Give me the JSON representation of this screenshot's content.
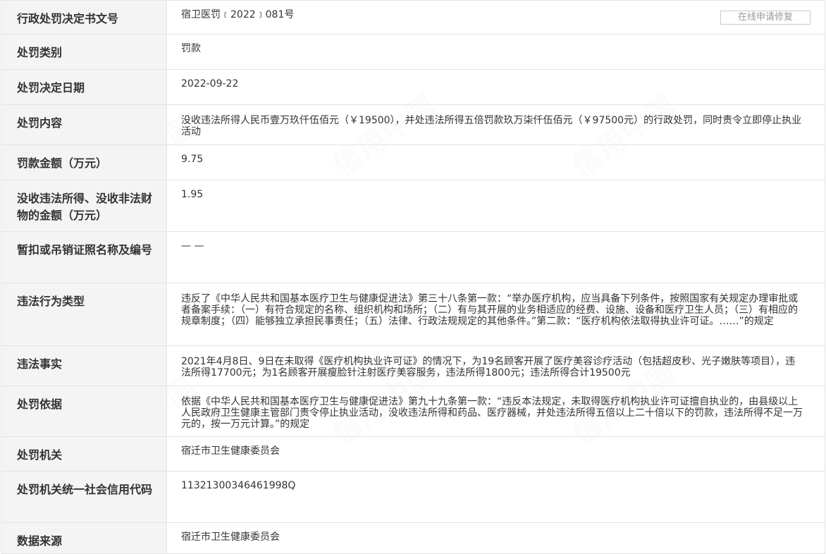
{
  "repair_button_label": "在线申请修复",
  "watermark_text": "信用中国",
  "rows": [
    {
      "label": "行政处罚决定书文号",
      "value": "宿卫医罚﹝2022﹞081号"
    },
    {
      "label": "处罚类别",
      "value": "罚款"
    },
    {
      "label": "处罚决定日期",
      "value": "2022-09-22"
    },
    {
      "label": "处罚内容",
      "value": "没收违法所得人民币壹万玖仟伍佰元（￥19500），并处违法所得五倍罚款玖万柒仟伍佰元（￥97500元）的行政处罚，同时责令立即停止执业活动"
    },
    {
      "label": "罚款金额（万元）",
      "value": "9.75"
    },
    {
      "label": "没收违法所得、没收非法财物的金额（万元）",
      "value": "1.95"
    },
    {
      "label": "暂扣或吊销证照名称及编号",
      "value": "— —"
    },
    {
      "label": "违法行为类型",
      "value": "违反了《中华人民共和国基本医疗卫生与健康促进法》第三十八条第一款：“举办医疗机构，应当具备下列条件，按照国家有关规定办理审批或者备案手续：（一）有符合规定的名称、组织机构和场所；（二）有与其开展的业务相适应的经费、设施、设备和医疗卫生人员；（三）有相应的规章制度；（四）能够独立承担民事责任；（五）法律、行政法规规定的其他条件。”第二款：“医疗机构依法取得执业许可证。……”的规定"
    },
    {
      "label": "违法事实",
      "value": "2021年4月8日、9日在未取得《医疗机构执业许可证》的情况下，为19名顾客开展了医疗美容诊疗活动（包括超皮秒、光子嫩肤等项目），违法所得17700元；为1名顾客开展瘦脸针注射医疗美容服务，违法所得1800元；违法所得合计19500元"
    },
    {
      "label": "处罚依据",
      "value": "依据《中华人民共和国基本医疗卫生与健康促进法》第九十九条第一款：“违反本法规定，未取得医疗机构执业许可证擅自执业的，由县级以上人民政府卫生健康主管部门责令停止执业活动，没收违法所得和药品、医疗器械，并处违法所得五倍以上二十倍以下的罚款，违法所得不足一万元的，按一万元计算。”的规定"
    },
    {
      "label": "处罚机关",
      "value": "宿迁市卫生健康委员会"
    },
    {
      "label": "处罚机关统一社会信用代码",
      "value": "11321300346461998Q"
    },
    {
      "label": "数据来源",
      "value": "宿迁市卫生健康委员会"
    }
  ]
}
